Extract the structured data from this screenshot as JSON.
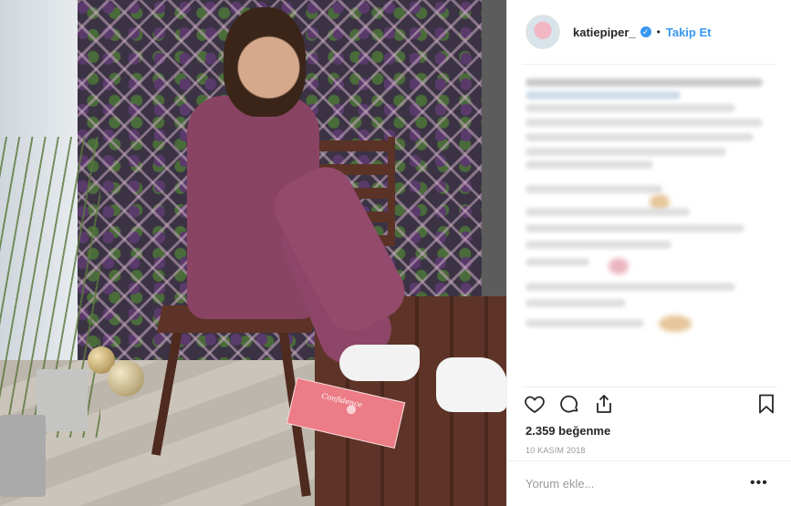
{
  "post": {
    "author": {
      "username": "katiepiper_",
      "verified_icon": "verified-badge-icon",
      "separator": "•",
      "follow_label": "Takip Et"
    },
    "image": {
      "book_title": "Confidence"
    },
    "actions": {
      "like_icon": "heart-icon",
      "comment_icon": "comment-bubble-icon",
      "share_icon": "share-upload-icon",
      "save_icon": "bookmark-icon"
    },
    "likes_text": "2.359 beğenme",
    "date_text": "10 KASIM 2018",
    "comment_input": {
      "placeholder": "Yorum ekle...",
      "value": ""
    },
    "more_label": "•••"
  },
  "colors": {
    "accent": "#3897f0",
    "text": "#262626",
    "muted": "#999999",
    "border": "#efefef"
  }
}
